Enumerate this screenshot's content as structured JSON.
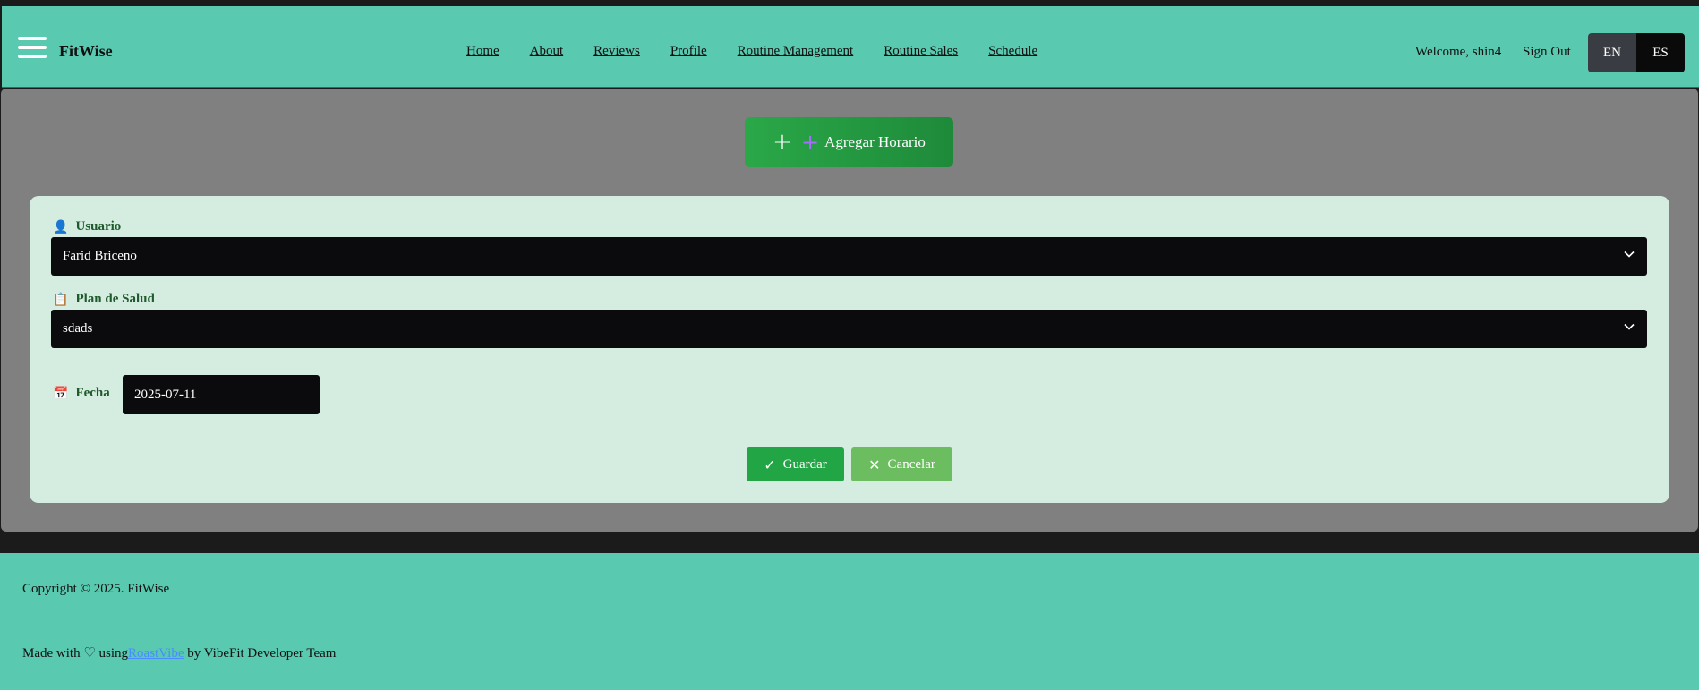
{
  "header": {
    "brand": "FitWise",
    "nav": [
      "Home",
      "About",
      "Reviews",
      "Profile",
      "Routine Management",
      "Routine Sales",
      "Schedule"
    ],
    "welcome": "Welcome, shin4",
    "sign_out": "Sign Out",
    "lang": {
      "en": "EN",
      "es": "ES",
      "active": "ES"
    }
  },
  "main": {
    "add_button_label": "Agregar Horario",
    "form": {
      "usuario_label": "Usuario",
      "usuario_value": "Farid Briceno",
      "plan_label": "Plan de Salud",
      "plan_value": "sdads",
      "fecha_label": "Fecha",
      "fecha_value": "2025-07-11",
      "save_label": "Guardar",
      "cancel_label": "Cancelar"
    }
  },
  "footer": {
    "copyright": "Copyright © 2025. FitWise",
    "made_with": "Made with",
    "using": "using",
    "link_text": "RoastVibe",
    "team": "by VibeFit Developer Team"
  },
  "colors": {
    "header_bg": "#59c9b0",
    "main_bg": "#808080",
    "card_bg": "#d5ede0",
    "accent_green": "#22a544",
    "cancel_green": "#6cbd5f"
  }
}
